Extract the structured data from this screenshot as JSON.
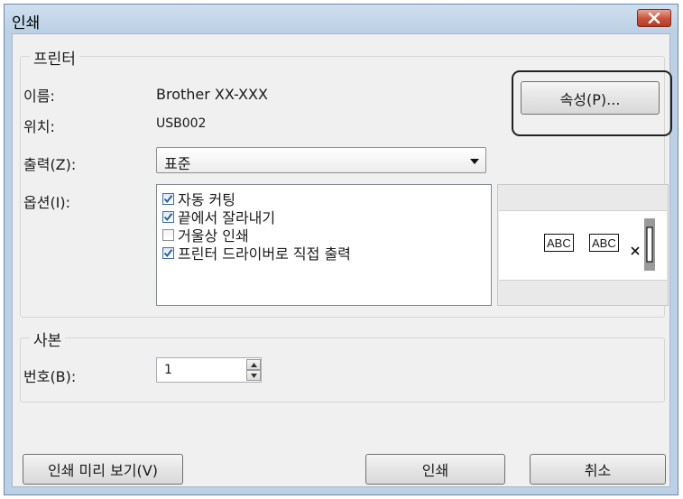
{
  "window": {
    "title": "인쇄",
    "close_icon": "close-icon",
    "accent": "#c9503a"
  },
  "printer_group": {
    "legend": "프린터",
    "name_label": "이름:",
    "name_value": "Brother XX-XXX",
    "location_label": "위치:",
    "location_value": "USB002",
    "properties_button": "속성(P)..."
  },
  "output": {
    "label": "출력(Z):",
    "selected": "표준"
  },
  "options": {
    "label": "옵션(I):",
    "items": [
      {
        "label": "자동 커팅",
        "checked": true
      },
      {
        "label": "끝에서 잘라내기",
        "checked": true
      },
      {
        "label": "거울상 인쇄",
        "checked": false
      },
      {
        "label": "프린터 드라이버로 직접 출력",
        "checked": true
      }
    ]
  },
  "preview": {
    "label1": "ABC",
    "label2": "ABC",
    "cut_icon": "scissors-icon",
    "tape_icon": "tape-end-icon"
  },
  "copies_group": {
    "legend": "사본",
    "number_label": "번호(B):",
    "number_value": "1"
  },
  "footer": {
    "preview_button": "인쇄 미리 보기(V)",
    "print_button": "인쇄",
    "cancel_button": "취소"
  }
}
